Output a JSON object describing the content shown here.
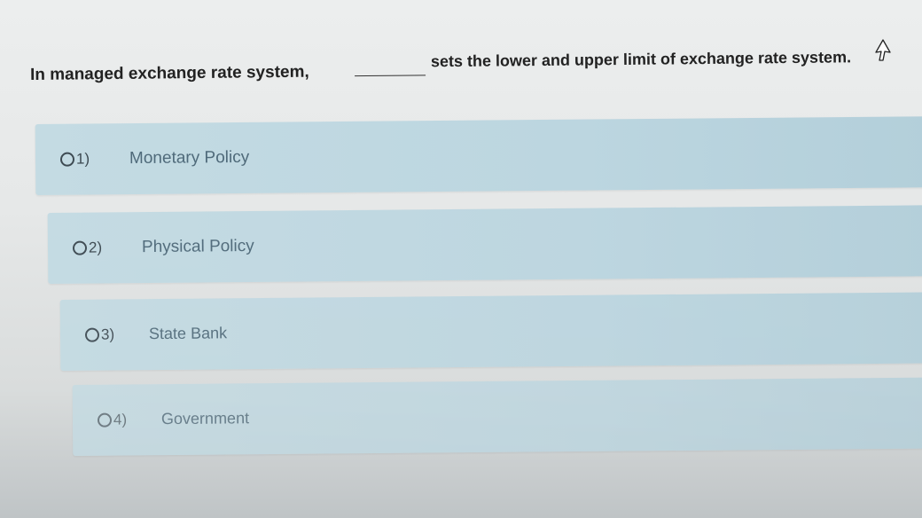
{
  "question": {
    "text_before": "In managed exchange rate system,",
    "text_after": "sets the lower and upper limit of exchange rate system."
  },
  "options": [
    {
      "number": "1)",
      "label": "Monetary Policy"
    },
    {
      "number": "2)",
      "label": "Physical Policy"
    },
    {
      "number": "3)",
      "label": "State Bank"
    },
    {
      "number": "4)",
      "label": "Government"
    }
  ],
  "icons": {
    "cursor": "arrow-pointer-icon",
    "radio": "radio-unselected-icon"
  },
  "colors": {
    "option_background": "#bcd6e0",
    "label_text": "#4f6a7a",
    "question_text": "#222222"
  }
}
